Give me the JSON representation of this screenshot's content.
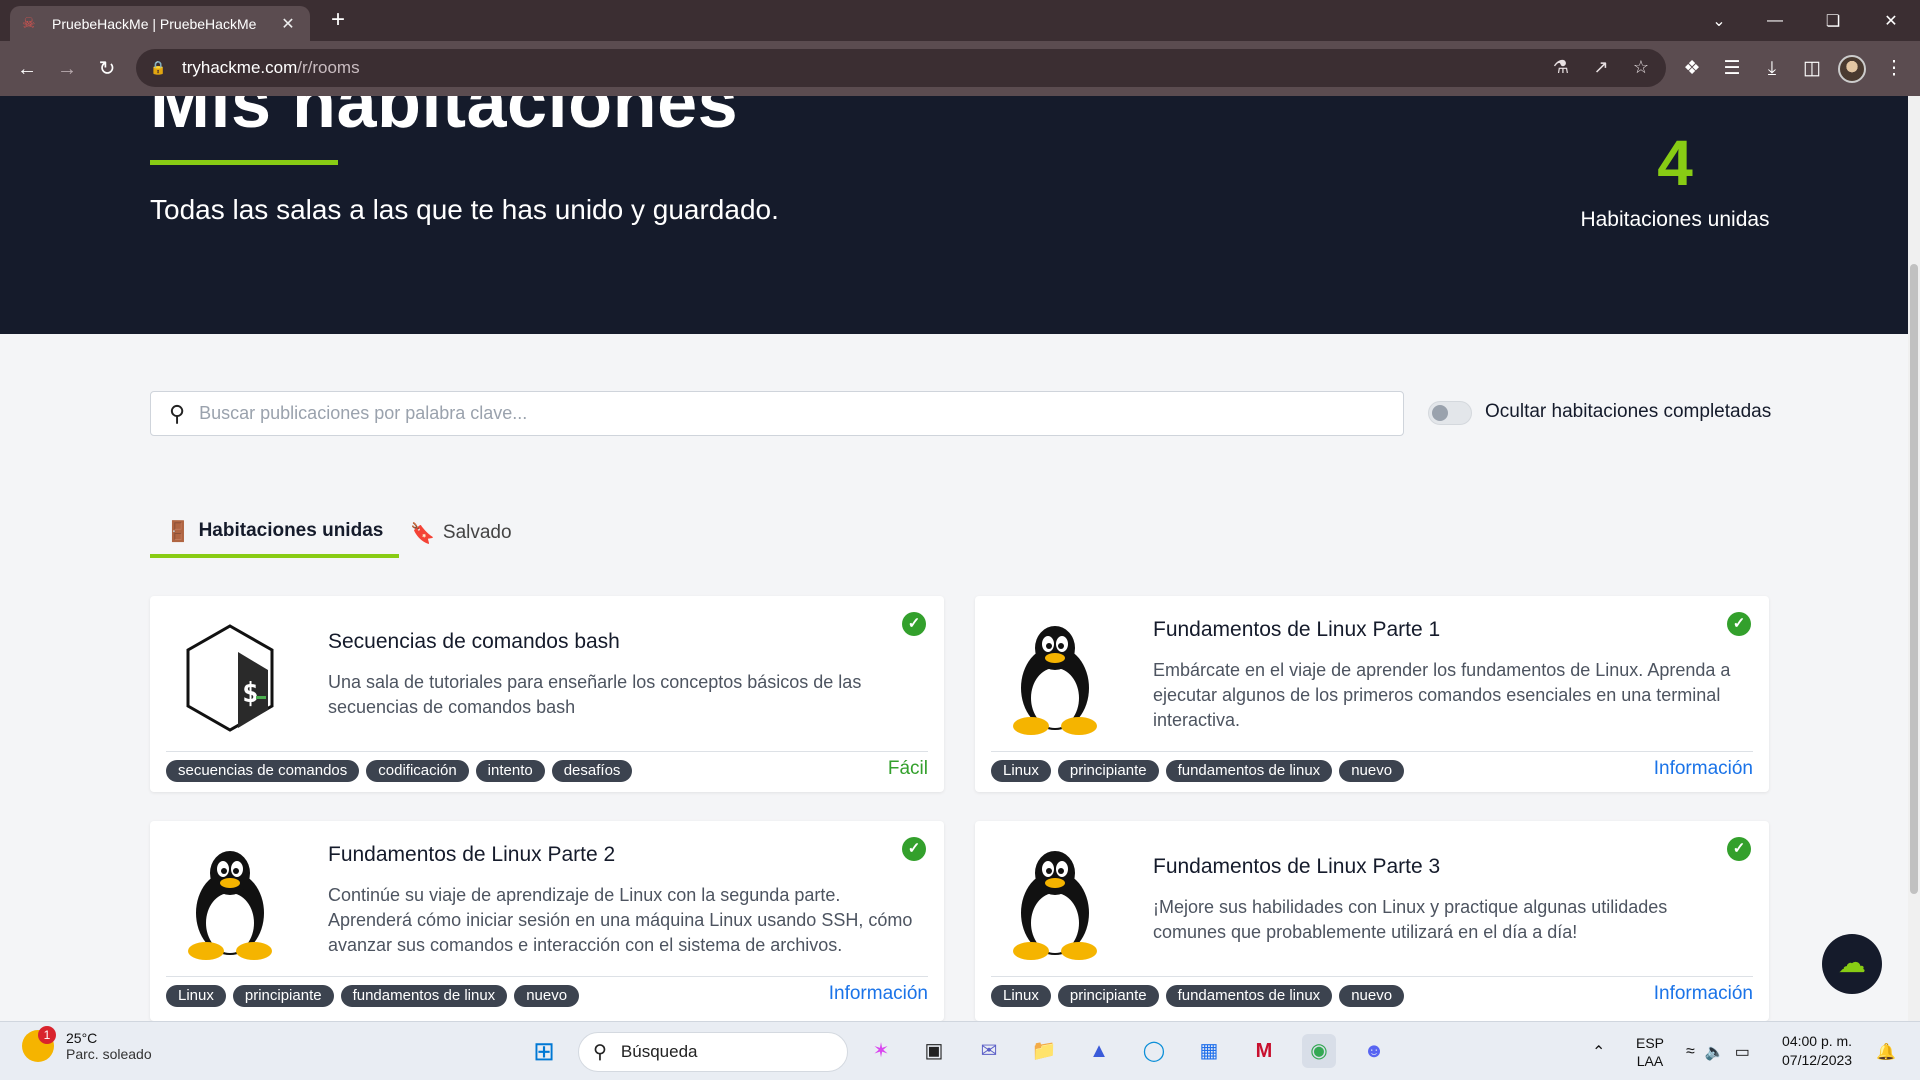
{
  "browser": {
    "tab_title": "PruebeHackMe | PruebeHackMe",
    "url_host": "tryhackme.com",
    "url_path": "/r/rooms"
  },
  "hero": {
    "title": "Mis habitaciones",
    "subtitle": "Todas las salas a las que te has unido y guardado.",
    "stat_value": "4",
    "stat_label": "Habitaciones unidas"
  },
  "search": {
    "placeholder": "Buscar publicaciones por palabra clave..."
  },
  "toggle": {
    "label": "Ocultar habitaciones completadas"
  },
  "tabs": {
    "joined": "Habitaciones unidas",
    "saved": "Salvado"
  },
  "rooms": [
    {
      "title": "Secuencias de comandos bash",
      "description": "Una sala de tutoriales para enseñarle los conceptos básicos de las secuencias de comandos bash",
      "tags": [
        "secuencias de comandos",
        "codificación",
        "intento",
        "desafíos"
      ],
      "difficulty": "Fácil",
      "icon": "bash-logo-icon"
    },
    {
      "title": "Fundamentos de Linux Parte 1",
      "description": "Embárcate en el viaje de aprender los fundamentos de Linux. Aprenda a ejecutar algunos de los primeros comandos esenciales en una terminal interactiva.",
      "tags": [
        "Linux",
        "principiante",
        "fundamentos de linux",
        "nuevo"
      ],
      "difficulty": "Información",
      "icon": "tux-penguin-icon"
    },
    {
      "title": "Fundamentos de Linux Parte 2",
      "description": "Continúe su viaje de aprendizaje de Linux con la segunda parte. Aprenderá cómo iniciar sesión en una máquina Linux usando SSH, cómo avanzar sus comandos e interacción con el sistema de archivos.",
      "tags": [
        "Linux",
        "principiante",
        "fundamentos de linux",
        "nuevo"
      ],
      "difficulty": "Información",
      "icon": "tux-penguin-icon"
    },
    {
      "title": "Fundamentos de Linux Parte 3",
      "description": "¡Mejore sus habilidades con Linux y practique algunas utilidades comunes que probablemente utilizará en el día a día!",
      "tags": [
        "Linux",
        "principiante",
        "fundamentos de linux",
        "nuevo"
      ],
      "difficulty": "Información",
      "icon": "tux-penguin-icon"
    }
  ],
  "colors": {
    "accent": "#88cc14",
    "hero_bg": "#151b2b",
    "easy": "#33a02c",
    "info": "#1a73e8",
    "tag_bg": "#3c434f"
  },
  "taskbar": {
    "weather_badge": "1",
    "temperature": "25°C",
    "condition": "Parc. soleado",
    "search_label": "Búsqueda",
    "lang_1": "ESP",
    "lang_2": "LAA",
    "time": "04:00 p. m.",
    "date": "07/12/2023"
  }
}
